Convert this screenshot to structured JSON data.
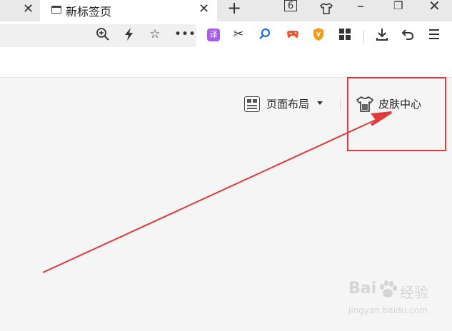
{
  "tabs": {
    "active_title": "新标签页",
    "tab_count": "6"
  },
  "icons": {
    "close": "close-icon",
    "new_tab": "plus-icon",
    "minimize": "minimize-icon",
    "restore": "restore-icon",
    "window_close": "close-icon",
    "skin_tab": "tshirt-icon",
    "zoom": "zoom-in-icon",
    "accelerate": "lightning-icon",
    "favorite": "star-icon",
    "more": "ellipsis-icon",
    "translate": "translate-icon",
    "screenshot": "scissors-icon",
    "search_ext": "search-icon",
    "game": "gamepad-icon",
    "shield": "shield-icon",
    "apps": "grid-icon",
    "download": "download-icon",
    "undo": "undo-icon",
    "menu": "menu-icon"
  },
  "extensions": {
    "translate_label": "译"
  },
  "newtab_page": {
    "layout_label": "页面布局",
    "skin_label": "皮肤中心"
  },
  "colors": {
    "annotation": "#e23a3a",
    "translate_badge": "#a65ee8",
    "game_badge": "#f5542b",
    "shield_badge": "#f39a1b",
    "search_ext": "#1f6fe0"
  },
  "watermark": {
    "brand": "Bai",
    "brand2": "经验",
    "url": "jingyan.baidu.com"
  }
}
